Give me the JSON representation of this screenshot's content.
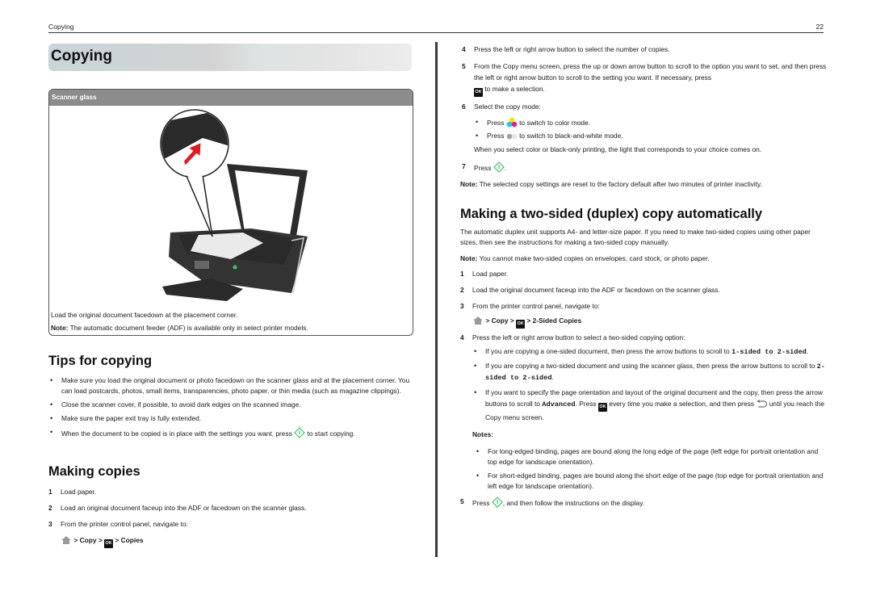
{
  "header": {
    "section": "Copying",
    "page_number": "22"
  },
  "chapter_title": "Copying",
  "figure": {
    "title": "Scanner glass",
    "caption": "Load the original document facedown at the placement corner.",
    "note_label": "Note:",
    "note_text": " The automatic document feeder (ADF) is available only in select printer models."
  },
  "tips": {
    "heading": "Tips for copying",
    "items": [
      "Make sure you load the original document or photo facedown on the scanner glass and at the placement corner. You can load postcards, photos, small items, transparencies, photo paper, or thin media (such as magazine clippings).",
      "Close the scanner cover, if possible, to avoid dark edges on the scanned image.",
      "Make sure the paper exit tray is fully extended.",
      "When the document to be copied is in place with the settings you want, press",
      "to start copying."
    ]
  },
  "making_copies": {
    "heading": "Making copies",
    "steps": [
      {
        "n": "1",
        "text": "Load paper."
      },
      {
        "n": "2",
        "text": "Load an original document faceup into the ADF or facedown on the scanner glass."
      },
      {
        "n": "3",
        "text": "From the printer control panel, navigate to:"
      }
    ],
    "nav": {
      "sep": ">",
      "copy": "Copy",
      "ok": "OK",
      "target": "Copies"
    },
    "steps_cont": [
      {
        "n": "4",
        "text": "Press the left or right arrow button to select the number of copies."
      },
      {
        "n": "5",
        "text": "From the Copy menu screen, press the up or down arrow button to scroll to the option you want to set, and then press the left or right arrow button to scroll to the setting you want. If necessary, press",
        "text_after": "to make a selection."
      },
      {
        "n": "6",
        "text": "Select the copy mode:"
      },
      {
        "n": "7",
        "text": "Press",
        "text_after": "."
      }
    ],
    "mode_options": [
      {
        "pre": "Press",
        "post": "to switch to color mode."
      },
      {
        "pre": "Press",
        "post": "to switch to black-and-white mode."
      }
    ],
    "mode_note": "When you select color or black-only printing, the light that corresponds to your choice comes on.",
    "note_label": "Note:",
    "note_text": " The selected copy settings are reset to the factory default after two minutes of printer inactivity."
  },
  "duplex": {
    "heading": "Making a two-sided (duplex) copy automatically",
    "intro": "The automatic duplex unit supports A4- and letter-size paper. If you need to make two-sided copies using other paper sizes, then see the instructions for making a two-sided copy manually.",
    "note_label": "Note:",
    "note_text": " You cannot make two-sided copies on envelopes, card stock, or photo paper.",
    "steps": [
      {
        "n": "1",
        "text": "Load paper."
      },
      {
        "n": "2",
        "text": "Load the original document faceup into the ADF or facedown on the scanner glass."
      },
      {
        "n": "3",
        "text": "From the printer control panel, navigate to:"
      },
      {
        "n": "4",
        "text": "Press the left or right arrow button to select a two-sided copying option:"
      },
      {
        "n": "5",
        "text": "Press",
        "text_after": ", and then follow the instructions on the display."
      }
    ],
    "nav": {
      "sep": ">",
      "copy": "Copy",
      "ok": "OK",
      "target": "2-Sided Copies"
    },
    "options": [
      {
        "pre": "If you are copying a one-sided document, then press the arrow buttons to scroll to ",
        "code": "1-sided to 2-sided",
        "post": "."
      },
      {
        "pre": "If you are copying a two-sided document and using the scanner glass, then press the arrow buttons to scroll to ",
        "code": "2-sided to 2-sided",
        "post": "."
      },
      {
        "pre": "If you want to specify the page orientation and layout of the original document and the copy, then press the arrow buttons to scroll to ",
        "code": "Advanced",
        "mid": ". Press",
        "mid2": "every time you make a selection, and then press",
        "post": "until you reach the Copy menu screen."
      }
    ],
    "notes_label": "Notes:",
    "notes": [
      "For long-edged binding, pages are bound along the long edge of the page (left edge for portrait orientation and top edge for landscape orientation).",
      "For short-edged binding, pages are bound along the short edge of the page (top edge for portrait orientation and left edge for landscape orientation)."
    ]
  },
  "colors": {
    "start_green": "#3cc46a",
    "home_gray": "#9a9a9a",
    "figure_header": "#8c8c8c",
    "arrow_red": "#e2191e"
  }
}
